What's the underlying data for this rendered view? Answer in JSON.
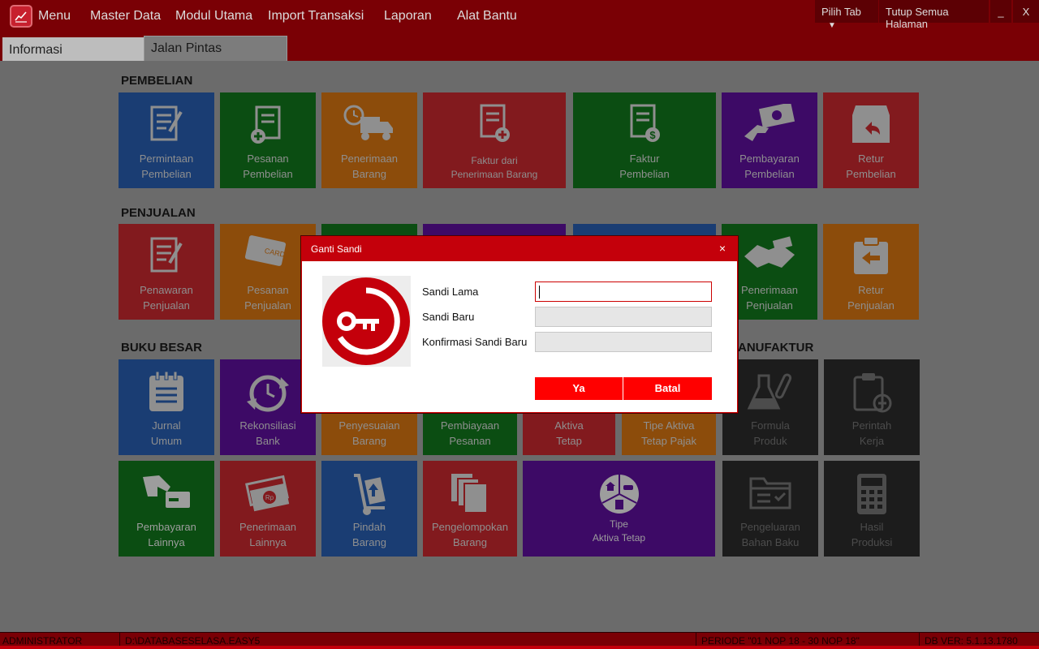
{
  "topbar": {
    "menu": [
      "Menu",
      "Master Data",
      "Modul Utama",
      "Import Transaksi",
      "Laporan",
      "Alat Bantu"
    ],
    "pilih_tab": "Pilih Tab",
    "tutup_semua": "Tutup Semua Halaman",
    "minimize": "_",
    "close": "X"
  },
  "tabs": [
    "Informasi",
    "Jalan Pintas"
  ],
  "sections": {
    "pembelian": "PEMBELIAN",
    "penjualan": "PENJUALAN",
    "buku_besar": "BUKU BESAR",
    "manufaktur": "ANUFAKTUR"
  },
  "tiles": {
    "permintaan_pembelian": "Permintaan\nPembelian",
    "pesanan_pembelian": "Pesanan\nPembelian",
    "penerimaan_barang": "Penerimaan\nBarang",
    "faktur_dari_penerimaan": "Faktur dari\nPenerimaan Barang",
    "faktur_pembelian": "Faktur\nPembelian",
    "pembayaran_pembelian": "Pembayaran\nPembelian",
    "retur_pembelian": "Retur\nPembelian",
    "penawaran_penjualan": "Penawaran\nPenjualan",
    "pesanan_penjualan": "Pesanan\nPenjualan",
    "penerimaan_penjualan": "Penerimaan\nPenjualan",
    "retur_penjualan": "Retur\nPenjualan",
    "jurnal_umum": "Jurnal\nUmum",
    "rekonsiliasi_bank": "Rekonsiliasi\nBank",
    "penyesuaian_barang": "Penyesuaian\nBarang",
    "pembiayaan_pesanan": "Pembiayaan\nPesanan",
    "aktiva_tetap": "Aktiva\nTetap",
    "tipe_aktiva_tetap_pajak": "Tipe Aktiva\nTetap Pajak",
    "formula_produk": "Formula\nProduk",
    "perintah_kerja": "Perintah\nKerja",
    "pembayaran_lainnya": "Pembayaran\nLainnya",
    "penerimaan_lainnya": "Penerimaan\nLainnya",
    "pindah_barang": "Pindah\nBarang",
    "pengelompokan_barang": "Pengelompokan\nBarang",
    "tipe_aktiva_tetap": "Tipe\nAktiva Tetap",
    "pengeluaran_bahan_baku": "Pengeluaran\nBahan Baku",
    "hasil_produksi": "Hasil\nProduksi"
  },
  "dialog": {
    "title": "Ganti Sandi",
    "close": "×",
    "label_old": "Sandi Lama",
    "label_new": "Sandi Baru",
    "label_confirm": "Konfirmasi Sandi Baru",
    "value_old": "",
    "value_new": "",
    "value_confirm": "",
    "btn_ok": "Ya",
    "btn_cancel": "Batal"
  },
  "status": {
    "user": "ADMINISTRATOR",
    "db_path": "D:\\DATABASESELASA.EASY5",
    "periode": "PERIODE \"01 NOP 18 - 30 NOP 18\"",
    "db_ver": "DB VER: 5.1.13.1780"
  },
  "colors": {
    "brand_red": "#c4000b",
    "topbar": "#7a0005",
    "button_red": "#ff0000"
  }
}
